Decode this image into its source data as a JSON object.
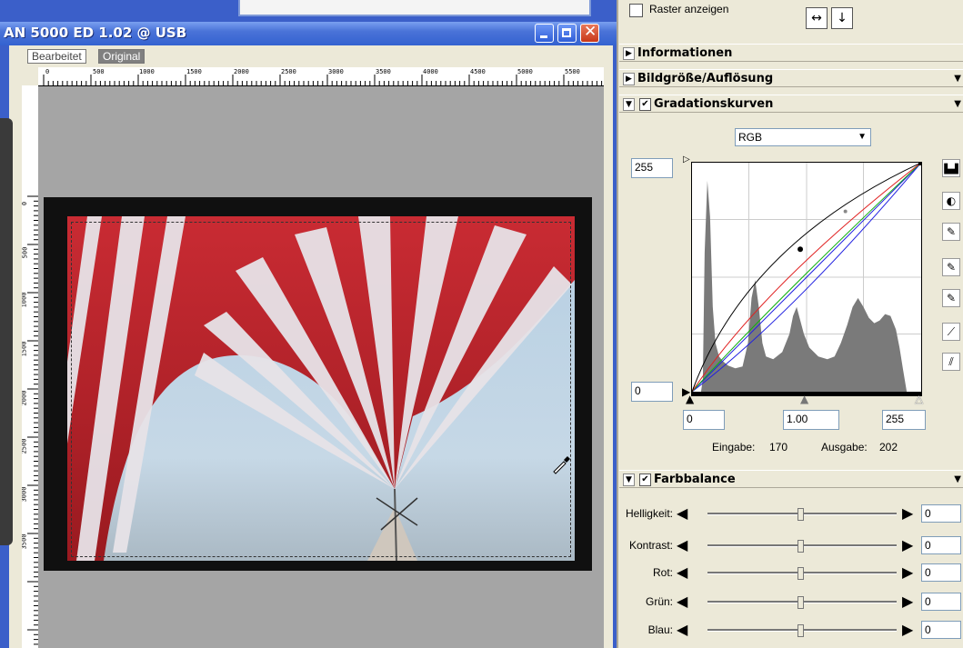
{
  "window": {
    "title": "AN 5000 ED 1.02 @ USB",
    "tabs": [
      "Bearbeitet",
      "Original"
    ],
    "ruler_top_labels": [
      "0",
      "500",
      "1000",
      "1500",
      "2000",
      "2500",
      "3000",
      "3500",
      "4000",
      "4500",
      "5000",
      "5500"
    ],
    "ruler_left_labels": [
      "0",
      "500",
      "1000",
      "1500",
      "2000",
      "2500",
      "3000",
      "3500"
    ]
  },
  "panel": {
    "raster_label": "Raster anzeigen",
    "sections": {
      "informationen": "Informationen",
      "bildgroesse": "Bildgröße/Auflösung",
      "gradation": "Gradationskurven",
      "farbbalance": "Farbbalance"
    },
    "curves": {
      "channel": "RGB",
      "output_max": "255",
      "output_min": "0",
      "input_min": "0",
      "gamma": "1.00",
      "input_max": "255",
      "input_label": "Eingabe:",
      "input_value": "170",
      "output_label": "Ausgabe:",
      "output_value": "202"
    },
    "color_balance": [
      {
        "label": "Helligkeit:",
        "value": "0"
      },
      {
        "label": "Kontrast:",
        "value": "0"
      },
      {
        "label": "Rot:",
        "value": "0"
      },
      {
        "label": "Grün:",
        "value": "0"
      },
      {
        "label": "Blau:",
        "value": "0"
      }
    ]
  },
  "colors": {
    "titlebar": "#3462d0",
    "close_button": "#d7442a",
    "canvas_bg": "#a5a5a5",
    "curve_red": "#e02020",
    "curve_green": "#10b010",
    "curve_blue": "#2020e0",
    "curve_black": "#000000",
    "histogram": "#7a7a7a"
  }
}
